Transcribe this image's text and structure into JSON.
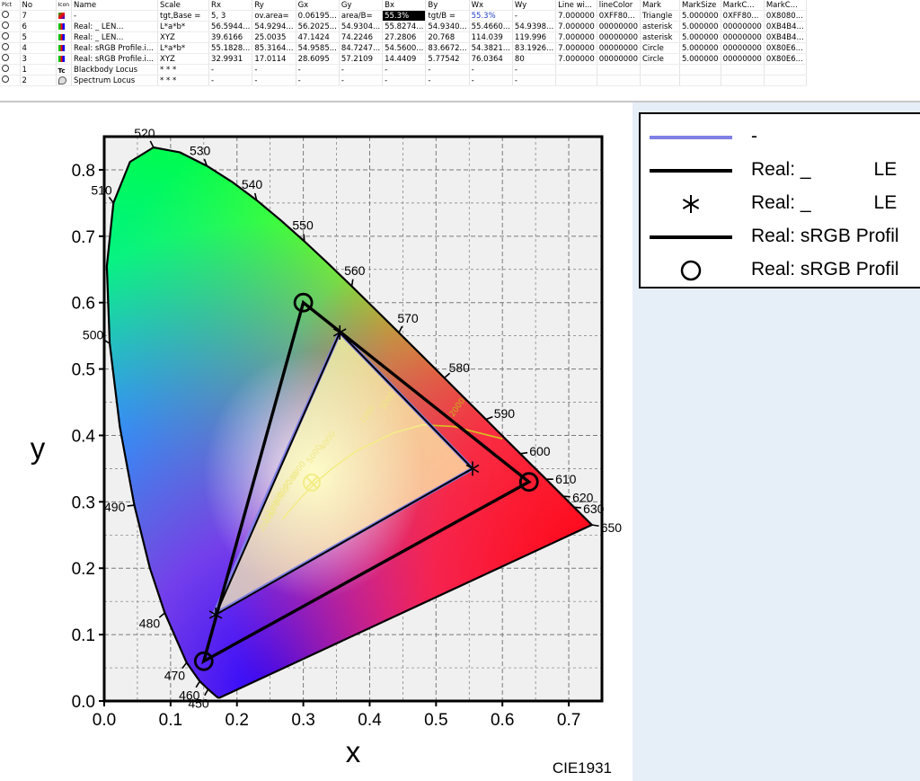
{
  "table": {
    "columns": [
      "",
      "No",
      "",
      "Name",
      "Scale",
      "Rx",
      "Ry",
      "Gx",
      "Gy",
      "Bx",
      "By",
      "Wx",
      "Wy",
      "Line wi...",
      "lineColor",
      "Mark",
      "MarkSize",
      "MarkC...",
      "MarkC..."
    ],
    "header_icon_1": "vis-icon",
    "header_icon_2": "type-icon",
    "rows": [
      {
        "no": "7",
        "icon": "gamut-icon",
        "name": "-",
        "scale": "tgt,Base =",
        "rx": "5, 3",
        "ry": "ov.area=",
        "gx": "0.06195...",
        "gy": "area/B=",
        "bx": "55.3%",
        "by": "tgt/B =",
        "wx": "55.3%",
        "wy": "-",
        "lw": "7.000000",
        "lc": "0XFF80...",
        "mark": "Triangle",
        "ms": "5.000000",
        "mc1": "0XFF80...",
        "mc2": "0X8080..."
      },
      {
        "no": "6",
        "icon": "measure-icon",
        "name": "Real: _            LEN...",
        "scale": "L*a*b*",
        "rx": "56.5944...",
        "ry": "54.9294...",
        "gx": "56.2025...",
        "gy": "54.9304...",
        "bx": "55.8274...",
        "by": "54.9340...",
        "wx": "55.4660...",
        "wy": "54.9398...",
        "lw": "7.000000",
        "lc": "00000000",
        "mark": "asterisk",
        "ms": "5.000000",
        "mc1": "00000000",
        "mc2": "0XB4B4..."
      },
      {
        "no": "5",
        "icon": "measure-icon",
        "name": "Real: _            LEN...",
        "scale": "XYZ",
        "rx": "39.6166",
        "ry": "25.0035",
        "gx": "47.1424",
        "gy": "74.2246",
        "bx": "27.2806",
        "by": "20.768",
        "wx": "114.039",
        "wy": "119.996",
        "lw": "7.000000",
        "lc": "00000000",
        "mark": "asterisk",
        "ms": "5.000000",
        "mc1": "00000000",
        "mc2": "0XB4B4..."
      },
      {
        "no": "4",
        "icon": "measure-icon",
        "name": "Real: sRGB Profile.i...",
        "scale": "L*a*b*",
        "rx": "55.1828...",
        "ry": "85.3164...",
        "gx": "54.9585...",
        "gy": "84.7247...",
        "bx": "54.5600...",
        "by": "83.6672...",
        "wx": "54.3821...",
        "wy": "83.1926...",
        "lw": "7.000000",
        "lc": "00000000",
        "mark": "Circle",
        "ms": "5.000000",
        "mc1": "00000000",
        "mc2": "0X80E6..."
      },
      {
        "no": "3",
        "icon": "measure-icon",
        "name": "Real: sRGB Profile.i...",
        "scale": "XYZ",
        "rx": "32.9931",
        "ry": "17.0114",
        "gx": "28.6095",
        "gy": "57.2109",
        "bx": "14.4409",
        "by": "5.77542",
        "wx": "76.0364",
        "wy": "80",
        "lw": "7.000000",
        "lc": "00000000",
        "mark": "Circle",
        "ms": "5.000000",
        "mc1": "00000000",
        "mc2": "0X80E6..."
      },
      {
        "no": "1",
        "icon": "blackbody-icon",
        "icon_text": "Tc",
        "name": "Blackbody Locus",
        "scale": "* * *",
        "rx": "-",
        "ry": "-",
        "gx": "-",
        "gy": "-",
        "bx": "-",
        "by": "-",
        "wx": "-",
        "wy": "-",
        "lw": "",
        "lc": "",
        "mark": "",
        "ms": "",
        "mc1": "",
        "mc2": ""
      },
      {
        "no": "2",
        "icon": "spectrum-locus-icon",
        "name": "Spectrum Locus",
        "scale": "* * *",
        "rx": "-",
        "ry": "-",
        "gx": "-",
        "gy": "-",
        "bx": "-",
        "by": "-",
        "wx": "-",
        "wy": "-",
        "lw": "",
        "lc": "",
        "mark": "",
        "ms": "",
        "mc1": "",
        "mc2": ""
      }
    ]
  },
  "chart_data": {
    "type": "scatter",
    "title": "",
    "xlabel": "x",
    "ylabel": "y",
    "caption": "CIE1931",
    "xlim": [
      0.0,
      0.75
    ],
    "ylim": [
      0.0,
      0.85
    ],
    "xticks": [
      "0.0",
      "0.1",
      "0.2",
      "0.3",
      "0.4",
      "0.5",
      "0.6",
      "0.7"
    ],
    "yticks": [
      "0.0",
      "0.1",
      "0.2",
      "0.3",
      "0.4",
      "0.5",
      "0.6",
      "0.7",
      "0.8"
    ],
    "grid": true,
    "spectrum_locus": {
      "points": [
        [
          0.1741,
          0.005
        ],
        [
          0.1714,
          0.0051
        ],
        [
          0.1689,
          0.0069
        ],
        [
          0.1644,
          0.0109
        ],
        [
          0.1566,
          0.0177
        ],
        [
          0.144,
          0.0297
        ],
        [
          0.1241,
          0.0578
        ],
        [
          0.0913,
          0.1327
        ],
        [
          0.0687,
          0.2007
        ],
        [
          0.0454,
          0.295
        ],
        [
          0.0235,
          0.4127
        ],
        [
          0.0082,
          0.5384
        ],
        [
          0.0039,
          0.6548
        ],
        [
          0.0139,
          0.7502
        ],
        [
          0.0389,
          0.812
        ],
        [
          0.0743,
          0.8338
        ],
        [
          0.1142,
          0.8262
        ],
        [
          0.1547,
          0.8059
        ],
        [
          0.1929,
          0.7816
        ],
        [
          0.2296,
          0.7543
        ],
        [
          0.2658,
          0.7243
        ],
        [
          0.3016,
          0.6923
        ],
        [
          0.3373,
          0.6589
        ],
        [
          0.3731,
          0.6245
        ],
        [
          0.4087,
          0.5896
        ],
        [
          0.4441,
          0.5547
        ],
        [
          0.4788,
          0.5202
        ],
        [
          0.5125,
          0.4866
        ],
        [
          0.5448,
          0.4544
        ],
        [
          0.5752,
          0.4242
        ],
        [
          0.6029,
          0.3965
        ],
        [
          0.627,
          0.3725
        ],
        [
          0.6482,
          0.3514
        ],
        [
          0.6658,
          0.334
        ],
        [
          0.6801,
          0.3197
        ],
        [
          0.6915,
          0.3083
        ],
        [
          0.7006,
          0.2993
        ],
        [
          0.7079,
          0.292
        ],
        [
          0.714,
          0.2859
        ],
        [
          0.7347,
          0.2653
        ]
      ],
      "wavelength_labels": [
        {
          "nm": "450",
          "x": 0.1566,
          "y": 0.0177
        },
        {
          "nm": "460",
          "x": 0.144,
          "y": 0.0297
        },
        {
          "nm": "470",
          "x": 0.1241,
          "y": 0.0578
        },
        {
          "nm": "480",
          "x": 0.0913,
          "y": 0.1327
        },
        {
          "nm": "490",
          "x": 0.0454,
          "y": 0.295
        },
        {
          "nm": "500",
          "x": 0.0082,
          "y": 0.5384
        },
        {
          "nm": "510",
          "x": 0.0139,
          "y": 0.7502
        },
        {
          "nm": "520",
          "x": 0.0743,
          "y": 0.8338
        },
        {
          "nm": "530",
          "x": 0.1547,
          "y": 0.8059
        },
        {
          "nm": "540",
          "x": 0.2296,
          "y": 0.7543
        },
        {
          "nm": "550",
          "x": 0.3016,
          "y": 0.6923
        },
        {
          "nm": "560",
          "x": 0.3731,
          "y": 0.6245
        },
        {
          "nm": "570",
          "x": 0.4441,
          "y": 0.5547
        },
        {
          "nm": "580",
          "x": 0.5125,
          "y": 0.4866
        },
        {
          "nm": "590",
          "x": 0.5752,
          "y": 0.4242
        },
        {
          "nm": "600",
          "x": 0.627,
          "y": 0.3725
        },
        {
          "nm": "610",
          "x": 0.6658,
          "y": 0.334
        },
        {
          "nm": "620",
          "x": 0.6915,
          "y": 0.3083
        },
        {
          "nm": "630",
          "x": 0.7079,
          "y": 0.292
        },
        {
          "nm": "650",
          "x": 0.7347,
          "y": 0.2653
        }
      ]
    },
    "blackbody_locus": {
      "points": [
        [
          0.6,
          0.395
        ],
        [
          0.56,
          0.405
        ],
        [
          0.5267,
          0.4133
        ],
        [
          0.48,
          0.4159
        ],
        [
          0.4369,
          0.4041
        ],
        [
          0.3804,
          0.3767
        ],
        [
          0.3451,
          0.3516
        ],
        [
          0.3221,
          0.3318
        ],
        [
          0.3064,
          0.3166
        ],
        [
          0.2952,
          0.3048
        ],
        [
          0.287,
          0.2956
        ],
        [
          0.2807,
          0.2883
        ],
        [
          0.2758,
          0.2824
        ],
        [
          0.272,
          0.2776
        ],
        [
          0.2689,
          0.2737
        ]
      ],
      "cct_labels": [
        {
          "text": "1000",
          "x": 0.4,
          "y": 0.43
        },
        {
          "text": "2000",
          "x": 0.535,
          "y": 0.44
        },
        {
          "text": "3000",
          "x": 0.43,
          "y": 0.45
        },
        {
          "text": "4000",
          "x": 0.34,
          "y": 0.39
        },
        {
          "text": "5000",
          "x": 0.32,
          "y": 0.37
        },
        {
          "text": "6000",
          "x": 0.295,
          "y": 0.345
        },
        {
          "text": "7000",
          "x": 0.285,
          "y": 0.33
        },
        {
          "text": "8000",
          "x": 0.275,
          "y": 0.318
        },
        {
          "text": "9000",
          "x": 0.27,
          "y": 0.306
        },
        {
          "text": "10000",
          "x": 0.26,
          "y": 0.295
        },
        {
          "text": "15000",
          "x": 0.255,
          "y": 0.283
        },
        {
          "text": "20000",
          "x": 0.25,
          "y": 0.27
        }
      ]
    },
    "white_point": {
      "x": 0.3127,
      "y": 0.329
    },
    "series": [
      {
        "name": "-",
        "kind": "fill",
        "color": "#8080e6",
        "fill": "#ffffb4",
        "points": [
          [
            0.555,
            0.35
          ],
          [
            0.355,
            0.555
          ],
          [
            0.165,
            0.13
          ]
        ]
      },
      {
        "name": "Real: _            LE",
        "kind": "line",
        "color": "#000000",
        "points": [
          [
            0.555,
            0.35
          ],
          [
            0.355,
            0.555
          ],
          [
            0.168,
            0.13
          ]
        ]
      },
      {
        "name": "Real: _            LE",
        "kind": "marker",
        "marker": "asterisk",
        "color": "#000000",
        "points": [
          [
            0.555,
            0.35
          ],
          [
            0.355,
            0.555
          ],
          [
            0.168,
            0.13
          ]
        ]
      },
      {
        "name": "Real: sRGB Profil",
        "kind": "line",
        "color": "#000000",
        "points": [
          [
            0.64,
            0.33
          ],
          [
            0.3,
            0.6
          ],
          [
            0.15,
            0.06
          ]
        ]
      },
      {
        "name": "Real: sRGB Profil",
        "kind": "marker",
        "marker": "circle",
        "color": "#000000",
        "points": [
          [
            0.64,
            0.33
          ],
          [
            0.3,
            0.6
          ],
          [
            0.15,
            0.06
          ]
        ]
      }
    ]
  },
  "legend": {
    "placement": "right",
    "entries": [
      {
        "symbol": "line-blue",
        "label": "-"
      },
      {
        "symbol": "line-black",
        "label": "Real: _            LE"
      },
      {
        "symbol": "asterisk",
        "label": "Real: _            LE"
      },
      {
        "symbol": "line-black",
        "label": "Real: sRGB Profil"
      },
      {
        "symbol": "circle",
        "label": "Real: sRGB Profil"
      }
    ]
  }
}
